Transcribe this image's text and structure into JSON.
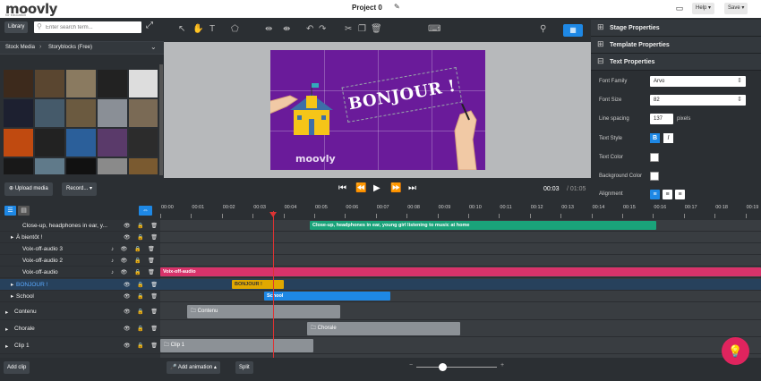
{
  "app": {
    "logo": "moovly",
    "logo_sub": "for education",
    "project_title": "Project 0"
  },
  "topbar": {
    "help_label": "Help ▾",
    "save_label": "Save ▾"
  },
  "library": {
    "library_label": "Library",
    "search_placeholder": "Enter search term...",
    "breadcrumb": [
      "Stock Media",
      "Storyblocks (Free)"
    ],
    "thumb_colors": [
      "#3d2a1c",
      "#5a4630",
      "#8a7a60",
      "#222",
      "#ddd",
      "#1d2030",
      "#455a6a",
      "#6b5a40",
      "#8a8f96",
      "#7a6a55",
      "#c04a10",
      "#222",
      "#2b5f9a",
      "#5a3a6a",
      "#2c2c2c",
      "#181818",
      "#607a8a",
      "#111",
      "#8a8a8a",
      "#7a5a30"
    ],
    "upload_label": "Upload media",
    "record_label": "Record... ▾"
  },
  "stage": {
    "text": "BONJOUR !",
    "watermark": "moovly",
    "bg_color": "#6a1b9a"
  },
  "playback": {
    "current": "00:03",
    "total": "/ 01:05"
  },
  "properties": {
    "sections": [
      "Stage Properties",
      "Template Properties",
      "Text Properties"
    ],
    "font_family_label": "Font Family",
    "font_family_value": "Arvo",
    "font_size_label": "Font Size",
    "font_size_value": "82",
    "line_spacing_label": "Line spacing",
    "line_spacing_value": "137",
    "line_spacing_unit": "pixels",
    "text_style_label": "Text Style",
    "bold": "B",
    "italic": "I",
    "text_color_label": "Text Color",
    "bg_color_label": "Background Color",
    "alignment_label": "Alignment"
  },
  "timeline": {
    "ticks": [
      "00:00",
      "00:01",
      "00:02",
      "00:03",
      "00:04",
      "00:05",
      "00:06",
      "00:07",
      "00:08",
      "00:09",
      "00:10",
      "00:11",
      "00:12",
      "00:13",
      "00:14",
      "00:15",
      "00:16",
      "00:17",
      "00:18",
      "00:19"
    ],
    "rows": [
      {
        "name": "Close-up, headphones in ear, y...",
        "clip": "Close-up, headphones in ear, young girl listening to music at home",
        "color": "#1aa37a"
      },
      {
        "name": "À bientôt !",
        "clip": "",
        "color": ""
      },
      {
        "name": "Voix-off-audio 3",
        "clip": "",
        "color": ""
      },
      {
        "name": "Voix-off-audio 2",
        "clip": "",
        "color": ""
      },
      {
        "name": "Voix-off-audio",
        "clip": "Voix-off-audio",
        "color": "#d8336a"
      },
      {
        "name": "BONJOUR !",
        "clip": "BONJOUR !",
        "color": "#e0a800"
      },
      {
        "name": "School",
        "clip": "School",
        "color": "#1e88e5"
      }
    ],
    "groups": [
      {
        "name": "Contenu",
        "clip": "Contenu"
      },
      {
        "name": "Chorale",
        "clip": "Chorale"
      },
      {
        "name": "Clip 1",
        "clip": "Clip 1"
      }
    ]
  },
  "bottom": {
    "add_clip": "Add clip",
    "add_animation": "Add animation ▴",
    "split": "Split"
  }
}
